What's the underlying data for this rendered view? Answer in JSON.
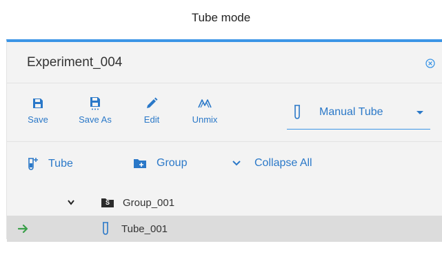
{
  "caption": "Tube mode",
  "panel": {
    "title": "Experiment_004",
    "accent_color": "#3b95e6",
    "link_color": "#2a78c8"
  },
  "toolbar": {
    "buttons": [
      {
        "label": "Save",
        "icon": "save-icon"
      },
      {
        "label": "Save As",
        "icon": "save-as-icon"
      },
      {
        "label": "Edit",
        "icon": "pencil-icon"
      },
      {
        "label": "Unmix",
        "icon": "unmix-icon"
      }
    ],
    "mode_select": {
      "icon": "tube-icon",
      "value": "Manual Tube"
    }
  },
  "actions": {
    "add_tube_label": "Tube",
    "add_group_label": "Group",
    "collapse_label": "Collapse All"
  },
  "tree": {
    "group": {
      "label": "Group_001",
      "badge": "S"
    },
    "tube": {
      "label": "Tube_001",
      "current_marker": "arrow-right-icon"
    }
  }
}
